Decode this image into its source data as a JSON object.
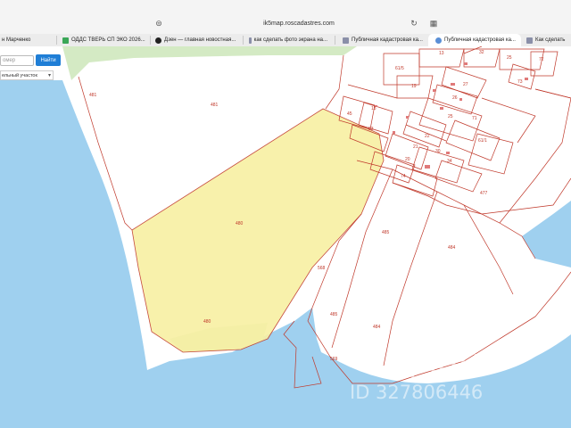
{
  "browser": {
    "url": "ik5map.roscadastres.com",
    "tabs": [
      {
        "label": "н Марченко"
      },
      {
        "label": "ОДДС ТВЕРЬ СП ЭКО 2026..."
      },
      {
        "label": "Дзен — главная новостная..."
      },
      {
        "label": "как сделать фото экрана на..."
      },
      {
        "label": "Публичная кадастровая ка..."
      },
      {
        "label": "Публичная кадастровая ка..."
      },
      {
        "label": "Как сделать"
      }
    ],
    "active_tab_index": 5
  },
  "map_controls": {
    "search_placeholder": "омер",
    "find_button": "Найти",
    "object_type": "ельный участок"
  },
  "parcels": {
    "p481a": "481",
    "p481b": "481",
    "p480a": "480",
    "p480b": "480",
    "p61_5": "61/5",
    "p13": "13",
    "p32": "32",
    "p25": "25",
    "p72": "72",
    "p19": "19",
    "p27": "27",
    "p73": "73",
    "p26": "26",
    "p45": "45",
    "p18": "18",
    "p53": "53",
    "p22": "22",
    "p25b": "25",
    "p71": "71",
    "p21": "21",
    "p30": "30",
    "p61_1": "61/1",
    "p20": "20",
    "p34": "34",
    "p74": "74",
    "p477": "477",
    "p485a": "485",
    "p484a": "484",
    "p568": "568",
    "p485b": "485",
    "p484b": "484",
    "p569": "569"
  },
  "watermark": {
    "word": "циан",
    "id": "ID 327806446"
  },
  "colors": {
    "water": "#9fd0ef",
    "selected_parcel": "#f8f0a3",
    "parcel_border": "#c0392b",
    "green_area": "#d4eac4",
    "accent_button": "#1f7ed6"
  }
}
